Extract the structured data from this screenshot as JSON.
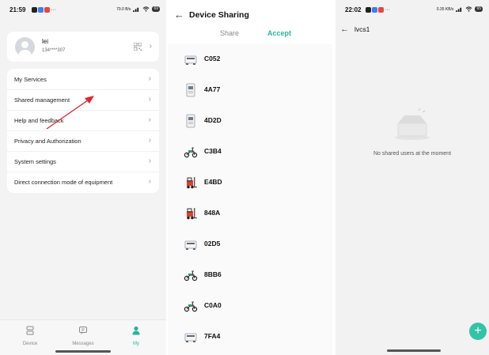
{
  "colors": {
    "accent": "#2bb59a",
    "fab": "#33c3a6",
    "arrow": "#e0262c"
  },
  "panel_my": {
    "status": {
      "time": "21:59",
      "net": "79.0 B/s",
      "battery": "69"
    },
    "profile": {
      "name": "lei",
      "phone": "134****307"
    },
    "menu": [
      {
        "label": "My Services"
      },
      {
        "label": "Shared management"
      },
      {
        "label": "Help and feedback"
      },
      {
        "label": "Privacy and Authorization"
      },
      {
        "label": "System settings"
      },
      {
        "label": "Direct connection mode of equipment"
      }
    ],
    "nav": [
      {
        "label": "Device",
        "icon": "device-icon"
      },
      {
        "label": "Messages",
        "icon": "messages-icon"
      },
      {
        "label": "My",
        "icon": "person-icon"
      }
    ]
  },
  "panel_sharing": {
    "title": "Device Sharing",
    "tabs": {
      "share": "Share",
      "accept": "Accept"
    },
    "devices": [
      {
        "name": "C052",
        "icon": "battery-box-icon"
      },
      {
        "name": "4A77",
        "icon": "cabinet-icon"
      },
      {
        "name": "4D2D",
        "icon": "cabinet-icon"
      },
      {
        "name": "C3B4",
        "icon": "scooter-icon"
      },
      {
        "name": "E4BD",
        "icon": "forklift-icon"
      },
      {
        "name": "848A",
        "icon": "forklift-icon"
      },
      {
        "name": "02D5",
        "icon": "battery-box-icon"
      },
      {
        "name": "8BB6",
        "icon": "scooter-icon"
      },
      {
        "name": "C0A0",
        "icon": "scooter-icon"
      },
      {
        "name": "7FA4",
        "icon": "battery-box-icon"
      }
    ]
  },
  "panel_users": {
    "status": {
      "time": "22:02",
      "net": "0.35 KB/s",
      "battery": "65"
    },
    "title": "lvcs1",
    "empty_text": "No shared users at the moment",
    "fab_symbol": "+"
  }
}
